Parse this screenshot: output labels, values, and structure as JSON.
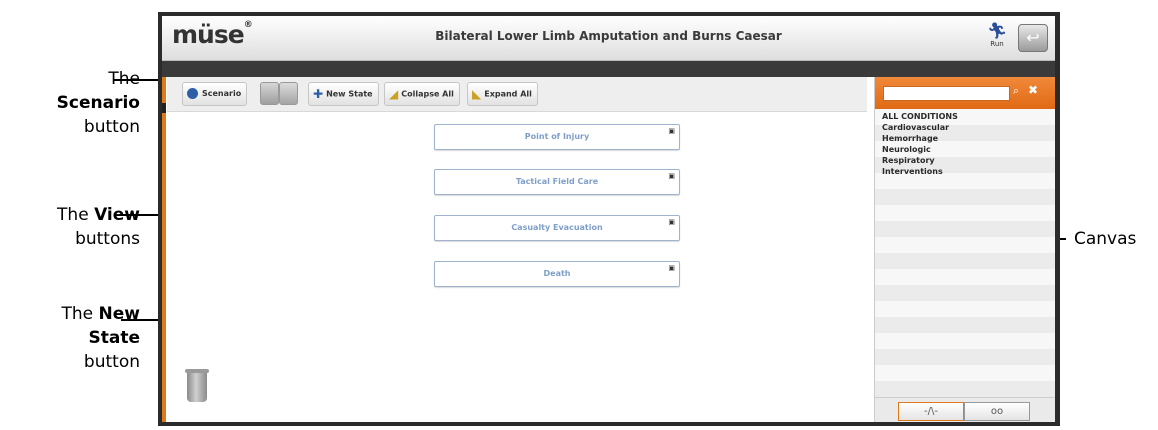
{
  "callouts": {
    "scenario": {
      "pre": "The",
      "bold": "Scenario",
      "post": "button"
    },
    "view": {
      "pre": "The",
      "bold": "View",
      "post": "buttons"
    },
    "newstate": {
      "pre": "The",
      "bold1": "New",
      "bold2": "State",
      "post": "button"
    },
    "canvas": "Canvas"
  },
  "app": {
    "logo": "müse",
    "logo_mark": "®",
    "title": "Bilateral Lower Limb Amputation and Burns Caesar",
    "run_label": "Run",
    "back_icon": "back-arrow-icon"
  },
  "toolbar": {
    "scenario": "Scenario",
    "new_state": "New State",
    "collapse_all": "Collapse All",
    "expand_all": "Expand All"
  },
  "states": [
    "Point of Injury",
    "Tactical Field Care",
    "Casualty Evacuation",
    "Death"
  ],
  "conditions": {
    "search_placeholder": "",
    "items": [
      "ALL CONDITIONS",
      "Cardiovascular",
      "Hemorrhage",
      "Neurologic",
      "Respiratory",
      "Interventions"
    ]
  },
  "tabs": {
    "vitals": "-/\\-",
    "tape": "oo"
  },
  "colors": {
    "accent": "#e0781c",
    "state_text": "#7f9fc8",
    "scenario_icon": "#2d5fa8"
  }
}
